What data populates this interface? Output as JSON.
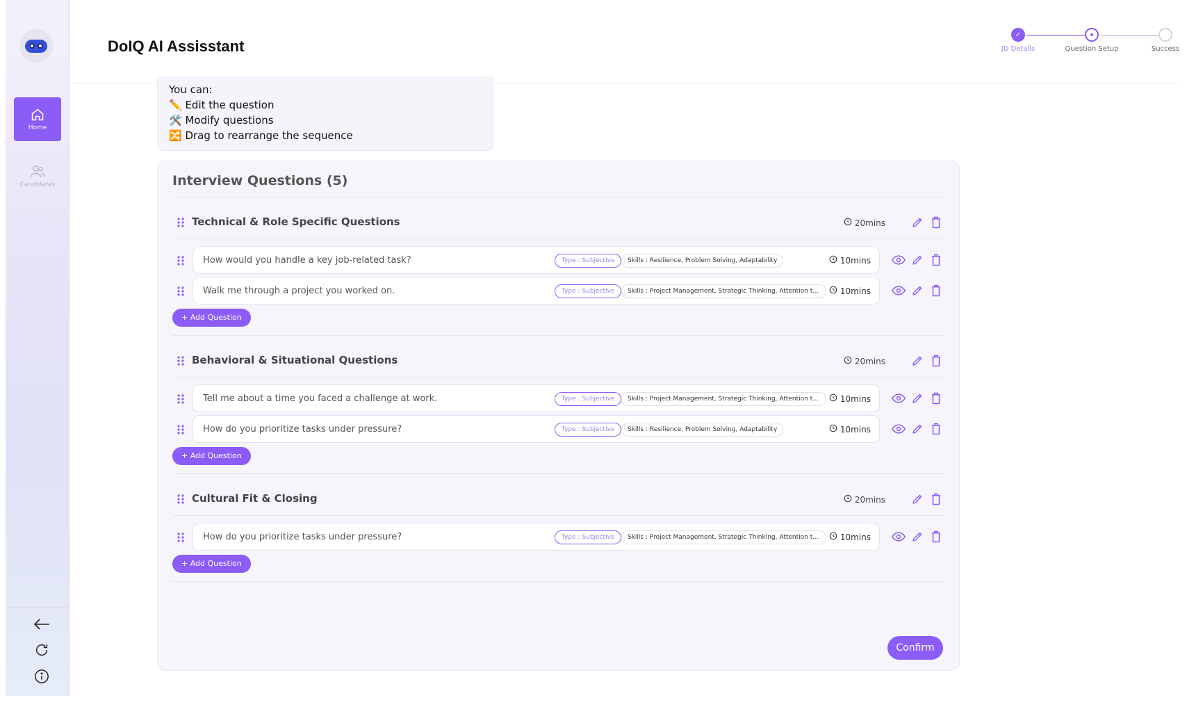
{
  "app": {
    "title": "DoIQ AI Assisstant"
  },
  "sidebar": {
    "items": [
      {
        "label": "Home",
        "icon": "home-icon",
        "active": true
      },
      {
        "label": "Candidates",
        "icon": "users-icon",
        "active": false
      }
    ],
    "bottom": [
      "arrow-left-icon",
      "refresh-icon",
      "info-icon"
    ]
  },
  "stepper": {
    "steps": [
      {
        "label": "JD Details",
        "state": "complete"
      },
      {
        "label": "Question Setup",
        "state": "current"
      },
      {
        "label": "Success",
        "state": "pending"
      }
    ]
  },
  "tips": {
    "intro": "You can:",
    "lines": [
      "✏️ Edit the question",
      "🛠️ Modify questions",
      "🔀 Drag to rearrange the sequence"
    ]
  },
  "interview": {
    "title": "Interview Questions (5)",
    "add_label": "+ Add Question",
    "confirm_label": "Confirm",
    "sections": [
      {
        "name": "Technical & Role Specific Questions",
        "time": "20mins",
        "questions": [
          {
            "text": "How would you handle a key job-related task?",
            "type": "Type : Subjective",
            "skills": "Skills : Resilience, Problem Solving, Adaptability",
            "time": "10mins"
          },
          {
            "text": "Walk me through a project you worked on.",
            "type": "Type : Subjective",
            "skills": "Skills : Project Management, Strategic Thinking, Attention to...",
            "time": "10mins"
          }
        ]
      },
      {
        "name": "Behavioral & Situational Questions",
        "time": "20mins",
        "questions": [
          {
            "text": "Tell me about a time you faced a challenge at work.",
            "type": "Type : Subjective",
            "skills": "Skills : Project Management, Strategic Thinking, Attention to...",
            "time": "10mins"
          },
          {
            "text": "How do you prioritize tasks under pressure?",
            "type": "Type : Subjective",
            "skills": "Skills : Resilience, Problem Solving, Adaptability",
            "time": "10mins"
          }
        ]
      },
      {
        "name": "Cultural Fit & Closing",
        "time": "20mins",
        "questions": [
          {
            "text": "How do you prioritize tasks under pressure?",
            "type": "Type : Subjective",
            "skills": "Skills : Project Management, Strategic Thinking, Attention to...",
            "time": "10mins"
          }
        ]
      }
    ]
  },
  "colors": {
    "accent": "#8b5cf6",
    "accent_light": "#b9a4f5",
    "card_bg": "#f6f5fb"
  }
}
